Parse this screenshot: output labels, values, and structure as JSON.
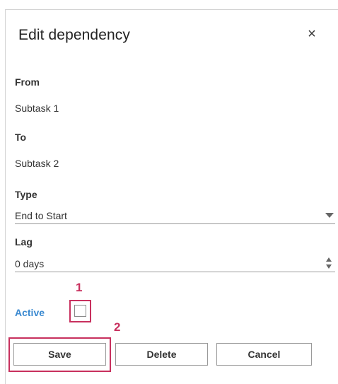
{
  "dialog": {
    "title": "Edit dependency",
    "close_glyph": "×",
    "close_icon": "close-icon"
  },
  "fields": {
    "from_label": "From",
    "from_value": "Subtask 1",
    "to_label": "To",
    "to_value": "Subtask 2",
    "type_label": "Type",
    "type_value": "End to Start",
    "lag_label": "Lag",
    "lag_value": "0 days"
  },
  "active": {
    "label": "Active",
    "checked": false
  },
  "buttons": {
    "save": "Save",
    "delete": "Delete",
    "cancel": "Cancel"
  },
  "annotations": {
    "marker_1": "1",
    "marker_2": "2",
    "color": "#c8305e"
  },
  "colors": {
    "accent": "#3a89d0"
  }
}
